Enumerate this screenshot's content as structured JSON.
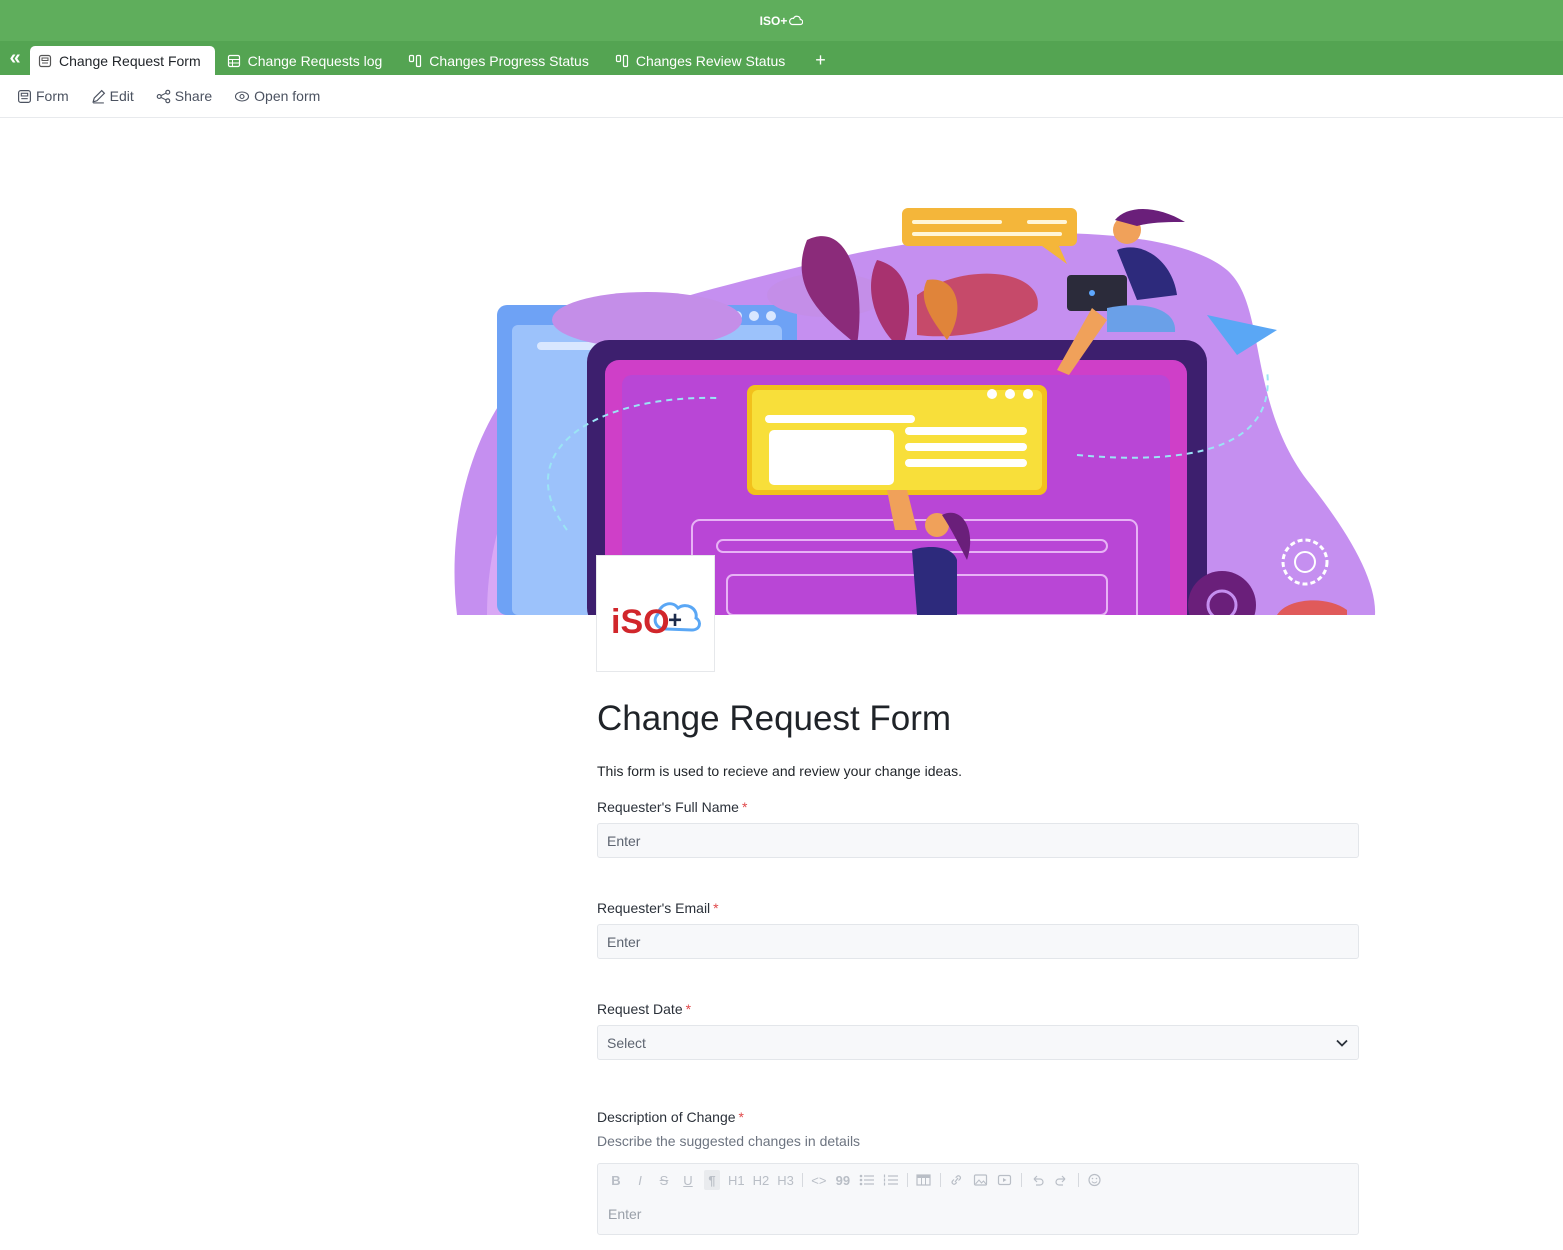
{
  "app": {
    "brand_text": "ISO+"
  },
  "tabs": [
    {
      "label": "Change Request Form",
      "icon": "form-icon",
      "active": true
    },
    {
      "label": "Change Requests log",
      "icon": "grid-icon",
      "active": false
    },
    {
      "label": "Changes Progress Status",
      "icon": "kanban-icon",
      "active": false
    },
    {
      "label": "Changes Review Status",
      "icon": "kanban-icon",
      "active": false
    }
  ],
  "tab_add": "+",
  "toolbar": {
    "form_label": "Form",
    "edit_label": "Edit",
    "share_label": "Share",
    "open_form_label": "Open form"
  },
  "logo": {
    "text": "iSO+",
    "colors": {
      "red": "#d1262b",
      "navy": "#1c2a4a"
    }
  },
  "form": {
    "title": "Change Request Form",
    "description": "This form is used to recieve and review your change ideas.",
    "required_mark": "*",
    "fields": [
      {
        "label": "Requester's Full Name",
        "placeholder": "Enter",
        "type": "text"
      },
      {
        "label": "Requester's Email",
        "placeholder": "Enter",
        "type": "text"
      },
      {
        "label": "Request Date",
        "placeholder": "Select",
        "type": "select"
      },
      {
        "label": "Description of Change",
        "hint": "Describe the suggested changes in details",
        "placeholder": "Enter",
        "type": "richtext"
      }
    ],
    "editor_tools": [
      "B",
      "I",
      "S",
      "U",
      "¶",
      "H1",
      "H2",
      "H3",
      "<>",
      "99"
    ]
  },
  "colors": {
    "top_green": "#5fae5c",
    "tab_green": "#54a452",
    "required": "#e0484a"
  }
}
